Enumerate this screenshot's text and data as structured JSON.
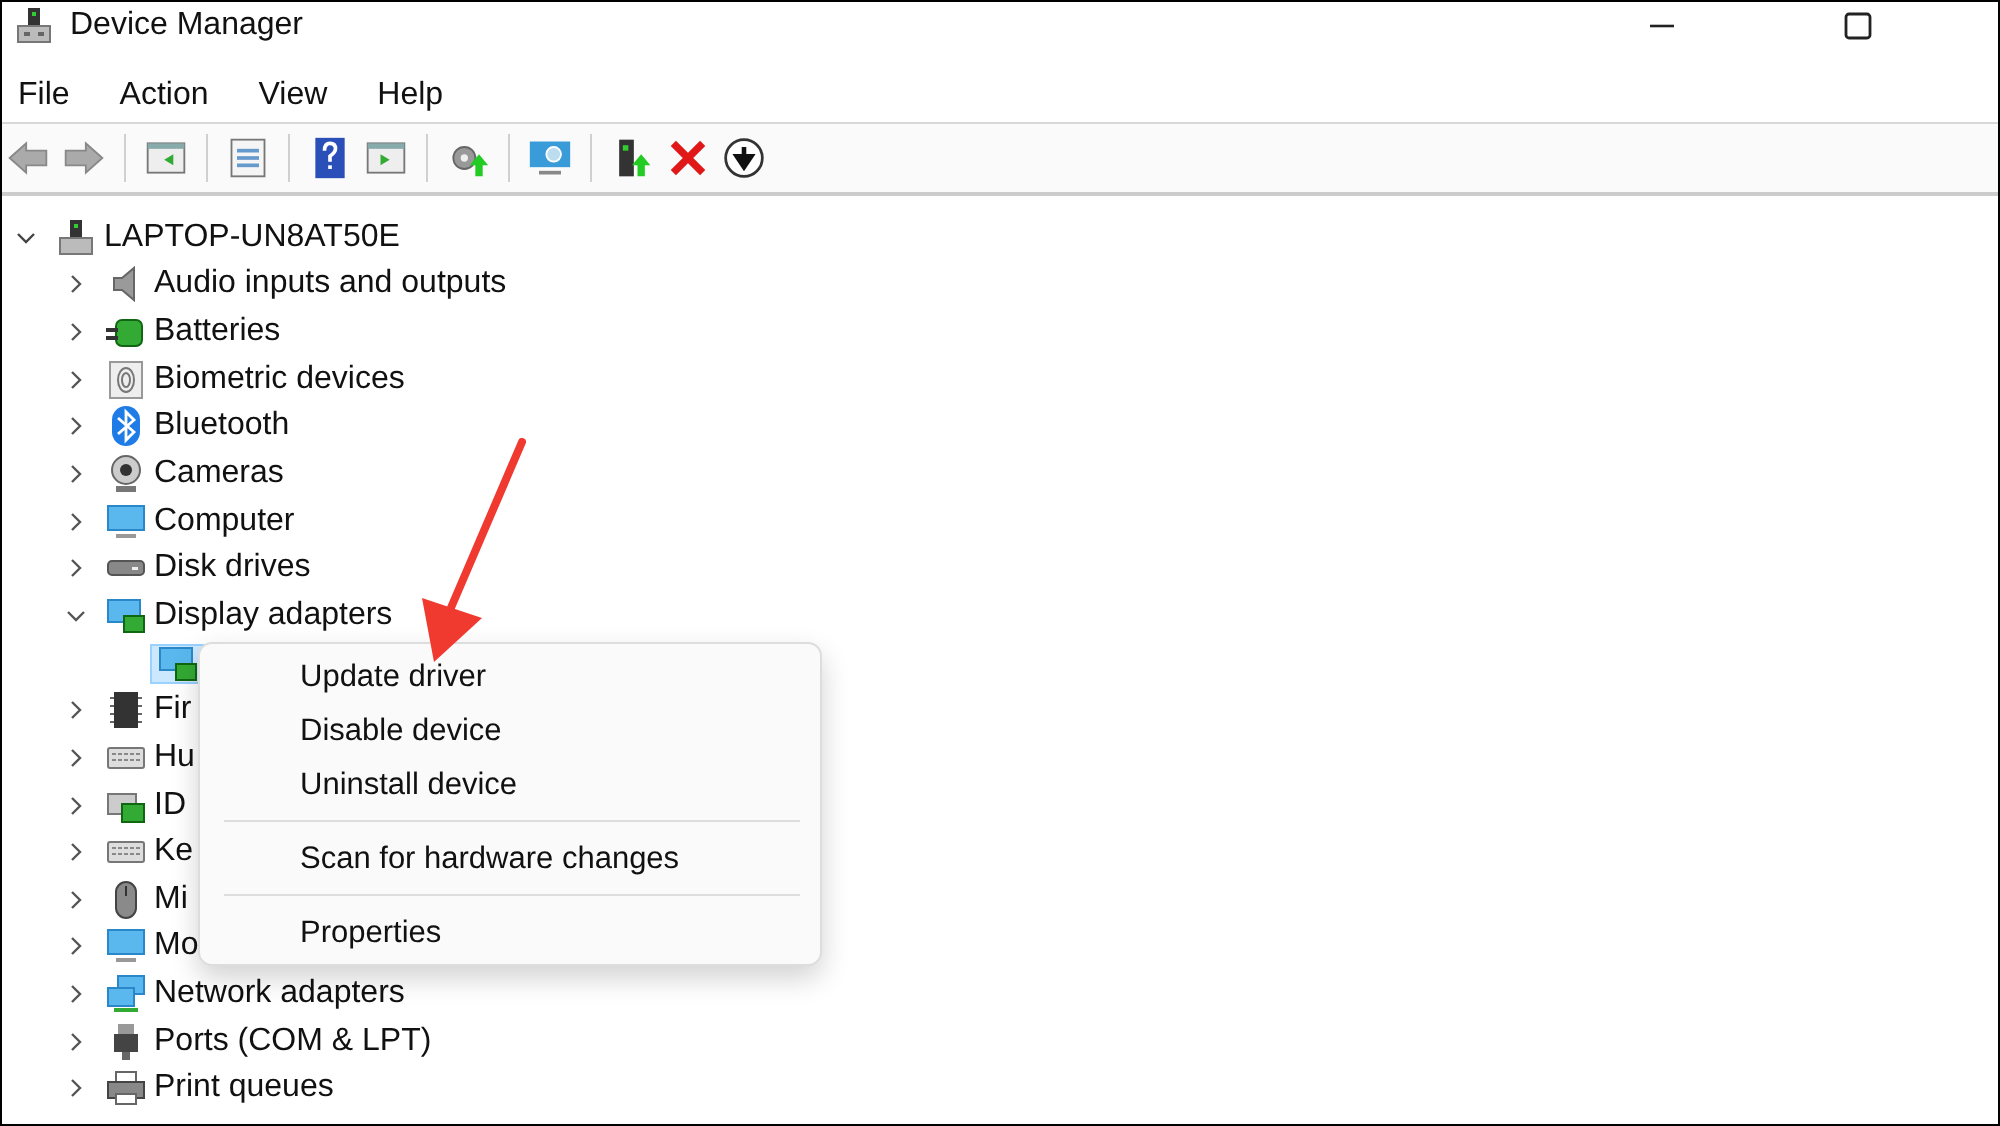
{
  "window": {
    "title": "Device Manager"
  },
  "menu_bar": [
    "File",
    "Action",
    "View",
    "Help"
  ],
  "tree": {
    "label": "LAPTOP-UN8AT50E",
    "expanded": true,
    "children": [
      {
        "label": "Audio inputs and outputs",
        "expanded": false
      },
      {
        "label": "Batteries",
        "expanded": false
      },
      {
        "label": "Biometric devices",
        "expanded": false
      },
      {
        "label": "Bluetooth",
        "expanded": false
      },
      {
        "label": "Cameras",
        "expanded": false
      },
      {
        "label": "Computer",
        "expanded": false
      },
      {
        "label": "Disk drives",
        "expanded": false
      },
      {
        "label": "Display adapters",
        "expanded": true,
        "children": [
          {
            "selected": true
          }
        ]
      },
      {
        "label": "Fir",
        "expanded": false
      },
      {
        "label": "Hu",
        "expanded": false
      },
      {
        "label": "ID",
        "expanded": false
      },
      {
        "label": "Ke",
        "expanded": false
      },
      {
        "label": "Mi",
        "expanded": false
      },
      {
        "label": "Mo",
        "expanded": false
      },
      {
        "label": "Network adapters",
        "expanded": false
      },
      {
        "label": "Ports (COM & LPT)",
        "expanded": false
      },
      {
        "label": "Print queues",
        "expanded": false
      }
    ]
  },
  "context_menu": {
    "groups": [
      [
        "Update driver",
        "Disable device",
        "Uninstall device"
      ],
      [
        "Scan for hardware changes"
      ],
      [
        "Properties"
      ]
    ]
  }
}
